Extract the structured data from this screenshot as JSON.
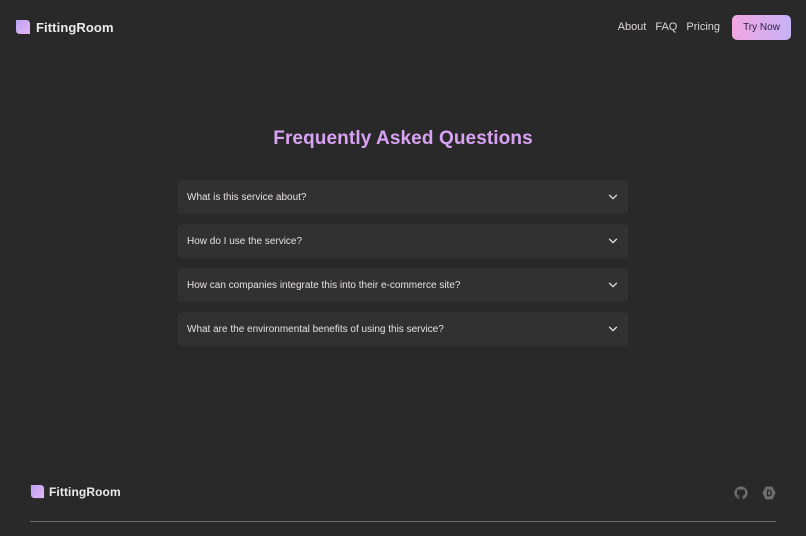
{
  "header": {
    "brand": "FittingRoom",
    "logo_icon": "leaf-logo-icon",
    "nav": [
      {
        "label": "About"
      },
      {
        "label": "FAQ"
      },
      {
        "label": "Pricing"
      }
    ],
    "cta_label": "Try Now"
  },
  "faq": {
    "title": "Frequently Asked Questions",
    "items": [
      {
        "question": "What is this service about?",
        "icon": "chevron-down-icon"
      },
      {
        "question": "How do I use the service?",
        "icon": "chevron-down-icon"
      },
      {
        "question": "How can companies integrate this into their e-commerce site?",
        "icon": "chevron-down-icon"
      },
      {
        "question": "What are the environmental benefits of using this service?",
        "icon": "chevron-down-icon"
      }
    ]
  },
  "footer": {
    "brand": "FittingRoom",
    "icons": [
      "github-icon",
      "devpost-icon"
    ]
  },
  "colors": {
    "background": "#2a2929",
    "accent_title": "#d7a3f2",
    "cta_gradient_start": "#f0a6e0",
    "cta_gradient_end": "#c8b2f7",
    "card": "#323131"
  }
}
